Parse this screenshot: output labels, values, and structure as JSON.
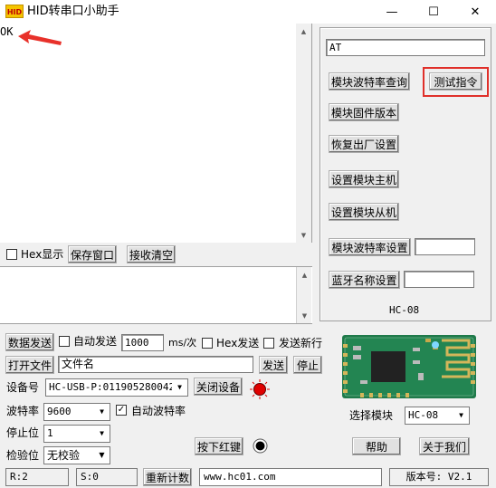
{
  "window": {
    "logo_text": "HID",
    "title": "HID转串口小助手",
    "minimize_glyph": "—",
    "maximize_glyph": "☐",
    "close_glyph": "✕"
  },
  "receive": {
    "text": "OK"
  },
  "send_tools": {
    "hex_display_label": "Hex显示",
    "save_window_label": "保存窗口",
    "clear_receive_label": "接收清空"
  },
  "right_panel": {
    "command_value": "AT",
    "buttons": {
      "baud_query": "模块波特率查询",
      "test_command": "测试指令",
      "firmware_version": "模块固件版本",
      "factory_reset": "恢复出厂设置",
      "set_master": "设置模块主机",
      "set_slave": "设置模块从机",
      "baud_set": "模块波特率设置",
      "bt_name_set": "蓝牙名称设置"
    },
    "baud_set_value": "",
    "bt_name_value": "",
    "module_name": "HC-08"
  },
  "send_controls": {
    "send_data_label": "数据发送",
    "auto_send_label": "自动发送",
    "interval_value": "1000",
    "interval_unit": "ms/次",
    "hex_send_label": "Hex发送",
    "send_newline_label": "发送新行",
    "open_file_label": "打开文件",
    "file_name_value": "文件名",
    "send_file_label": "发送",
    "stop_label": "停止"
  },
  "device": {
    "device_label": "设备号",
    "device_value": "HC-USB-P:011905280042",
    "close_device_label": "关闭设备",
    "baud_label": "波特率",
    "baud_value": "9600",
    "auto_baud_label": "自动波特率",
    "auto_baud_checked": "✓",
    "stop_bits_label": "停止位",
    "stop_bits_value": "1",
    "parity_label": "检验位",
    "parity_value": "无校验",
    "press_red_label": "按下红键"
  },
  "module_select": {
    "label": "选择模块",
    "value": "HC-08",
    "help_label": "帮助",
    "about_label": "关于我们"
  },
  "status_bar": {
    "rx": "R:2",
    "tx": "S:0",
    "recount_label": "重新计数",
    "website": "www.hc01.com",
    "version": "版本号: V2.1"
  },
  "colors": {
    "arrow_red": "#e8312a",
    "highlight_red": "#e0302a",
    "led_red": "#e00000",
    "pcb_green": "#1f7a4a"
  }
}
